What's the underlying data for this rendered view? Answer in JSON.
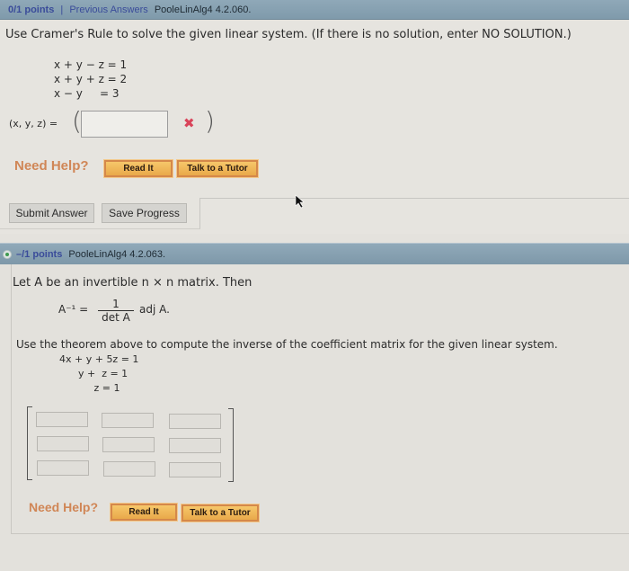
{
  "q1": {
    "header": {
      "points": "0/1 points",
      "separator": "|",
      "previous_answers": "Previous Answers",
      "problem_code": "PooleLinAlg4 4.2.060."
    },
    "prompt": "Use Cramer's Rule to solve the given linear system. (If there is no solution, enter NO SOLUTION.)",
    "equations": [
      "x + y − z = 1",
      "x + y + z = 2",
      "x − y     = 3"
    ],
    "answer_label": "(x, y, z) =",
    "answer_value": "",
    "answer_status_icon": "incorrect-x-icon",
    "need_help": "Need Help?",
    "read_it": "Read It",
    "talk_to_tutor": "Talk to a Tutor",
    "submit_answer": "Submit Answer",
    "save_progress": "Save Progress"
  },
  "q2": {
    "header": {
      "points": "–/1 points",
      "problem_code": "PooleLinAlg4 4.2.063."
    },
    "theorem_intro": "Let A be an invertible n × n matrix. Then",
    "formula": {
      "lhs": "A⁻¹ =",
      "numerator": "1",
      "denominator": "det A",
      "rhs": "adj A."
    },
    "instruction": "Use the theorem above to compute the inverse of the coefficient matrix for the given linear system.",
    "equations": [
      "4x + y + 5z = 1",
      "      y +  z = 1",
      "           z = 1"
    ],
    "matrix_values": [
      [
        "",
        "",
        ""
      ],
      [
        "",
        "",
        ""
      ],
      [
        "",
        "",
        ""
      ]
    ],
    "need_help": "Need Help?",
    "read_it": "Read It",
    "talk_to_tutor": "Talk to a Tutor"
  },
  "colors": {
    "header_bg": "#8aa3b4",
    "points_text": "#3a4c9a",
    "need_help_text": "#d08656",
    "help_button_bg": "#f0b85a",
    "incorrect_mark": "#d9445a"
  }
}
